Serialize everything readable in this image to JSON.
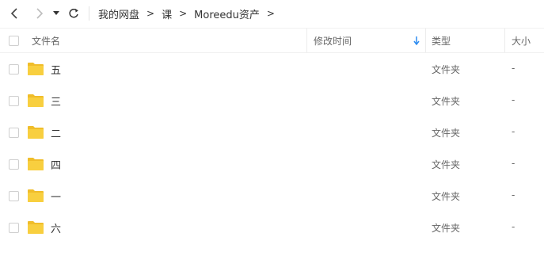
{
  "toolbar": {
    "back_icon": "chevron-left-icon",
    "forward_icon": "chevron-right-icon",
    "history_icon": "caret-down-icon",
    "refresh_icon": "refresh-icon"
  },
  "breadcrumb": {
    "items": [
      "我的网盘",
      "课",
      "Moreedu资产"
    ],
    "separator": ">"
  },
  "table": {
    "columns": {
      "name": "文件名",
      "modified": "修改时间",
      "type": "类型",
      "size": "大小"
    },
    "sort_indicator_color": "#2d8cf0",
    "rows": [
      {
        "name": "五",
        "modified": "",
        "type": "文件夹",
        "size": "-"
      },
      {
        "name": "三",
        "modified": "",
        "type": "文件夹",
        "size": "-"
      },
      {
        "name": "二",
        "modified": "",
        "type": "文件夹",
        "size": "-"
      },
      {
        "name": "四",
        "modified": "",
        "type": "文件夹",
        "size": "-"
      },
      {
        "name": "一",
        "modified": "",
        "type": "文件夹",
        "size": "-"
      },
      {
        "name": "六",
        "modified": "",
        "type": "文件夹",
        "size": "-"
      }
    ]
  },
  "colors": {
    "folder": "#f8cf3f",
    "folder_dark": "#f0bd2a",
    "accent": "#2d8cf0"
  }
}
